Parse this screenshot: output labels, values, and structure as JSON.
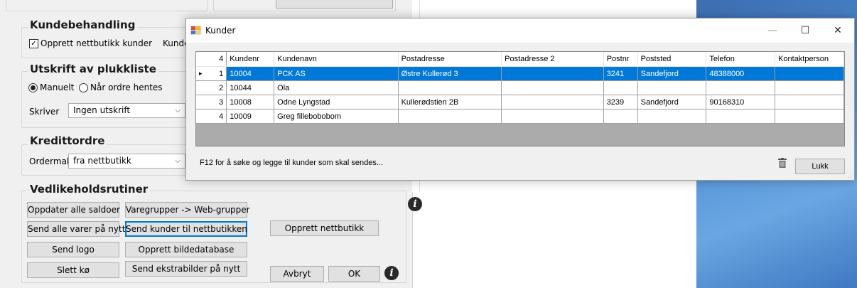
{
  "background": {
    "kundebehandling": {
      "title": "Kundebehandling",
      "opprett_label": "Opprett nettbutikk kunder",
      "opprett_checked": true,
      "kunde_cut": "Kunde"
    },
    "utskrift": {
      "title": "Utskrift av plukkliste",
      "radio_manuelt": "Manuelt",
      "radio_ordre": "Når ordre hentes",
      "skriver_label": "Skriver",
      "skriver_value": "Ingen utskrift"
    },
    "kredittordre": {
      "title": "Kredittordre",
      "ordermal_label": "Ordermal",
      "ordermal_value": "fra nettbutikk"
    },
    "vedlikehold": {
      "title": "Vedlikeholdsrutiner",
      "buttons": [
        "Oppdater alle saldoer",
        "Varegrupper -> Web-grupper",
        "Send alle varer på nytt",
        "Send kunder til nettbutikken",
        "Send logo",
        "Opprett bildedatabase",
        "Slett kø",
        "Send ekstrabilder på nytt",
        "Opprett nettbutikk"
      ]
    },
    "footer": {
      "avbryt": "Avbryt",
      "ok": "OK"
    }
  },
  "dialog": {
    "title": "Kunder",
    "controls": {
      "minimize": "—",
      "maximize": "☐",
      "close": "✕"
    },
    "grid": {
      "corner": "4",
      "columns": [
        "Kundenr",
        "Kundenavn",
        "Postadresse",
        "Postadresse 2",
        "Postnr",
        "Poststed",
        "Telefon",
        "Kontaktperson"
      ],
      "rows": [
        {
          "n": "1",
          "cells": [
            "10004",
            "PCK AS",
            "Østre Kullerød 3",
            "",
            "3241",
            "Sandefjord",
            "48388000",
            ""
          ]
        },
        {
          "n": "2",
          "cells": [
            "10044",
            "Ola",
            "",
            "",
            "",
            "",
            "",
            ""
          ]
        },
        {
          "n": "3",
          "cells": [
            "10008",
            "Odne Lyngstad",
            "Kullerødstien 2B",
            "",
            "3239",
            "Sandefjord",
            "90168310",
            ""
          ]
        },
        {
          "n": "4",
          "cells": [
            "10009",
            "Greg fillebobobom",
            "",
            "",
            "",
            "",
            "",
            ""
          ]
        }
      ],
      "selected_row": 0
    },
    "status": "F12 for å søke og legge til kunder som skal sendes...",
    "close_button": "Lukk"
  }
}
